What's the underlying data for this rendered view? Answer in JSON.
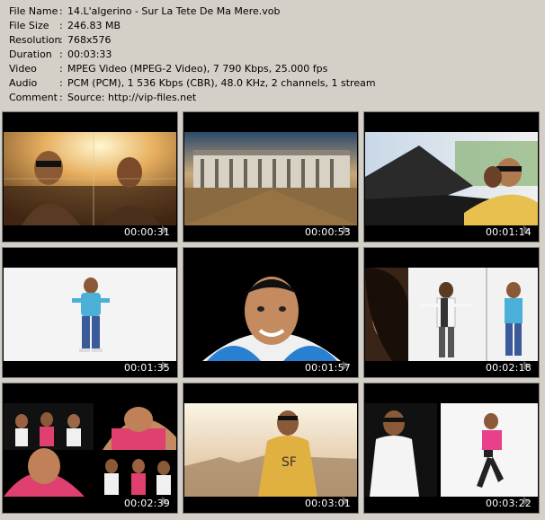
{
  "info": [
    {
      "label": "File Name",
      "value": "14.L'algerino - Sur La Tete De Ma Mere.vob"
    },
    {
      "label": "File Size",
      "value": "246.83 MB"
    },
    {
      "label": "Resolution",
      "value": "768x576"
    },
    {
      "label": "Duration",
      "value": "00:03:33"
    },
    {
      "label": "Video",
      "value": "MPEG Video (MPEG-2 Video), 7 790 Kbps, 25.000 fps"
    },
    {
      "label": "Audio",
      "value": "PCM (PCM), 1 536 Kbps (CBR), 48.0 KHz, 2 channels, 1 stream"
    },
    {
      "label": "Comment",
      "value": "Source: http://vip-files.net"
    }
  ],
  "colon": ":",
  "thumbnails": [
    {
      "time": "00:00:31"
    },
    {
      "time": "00:00:53"
    },
    {
      "time": "00:01:14"
    },
    {
      "time": "00:01:35"
    },
    {
      "time": "00:01:57"
    },
    {
      "time": "00:02:18"
    },
    {
      "time": "00:02:39"
    },
    {
      "time": "00:03:01"
    },
    {
      "time": "00:03:22"
    }
  ]
}
